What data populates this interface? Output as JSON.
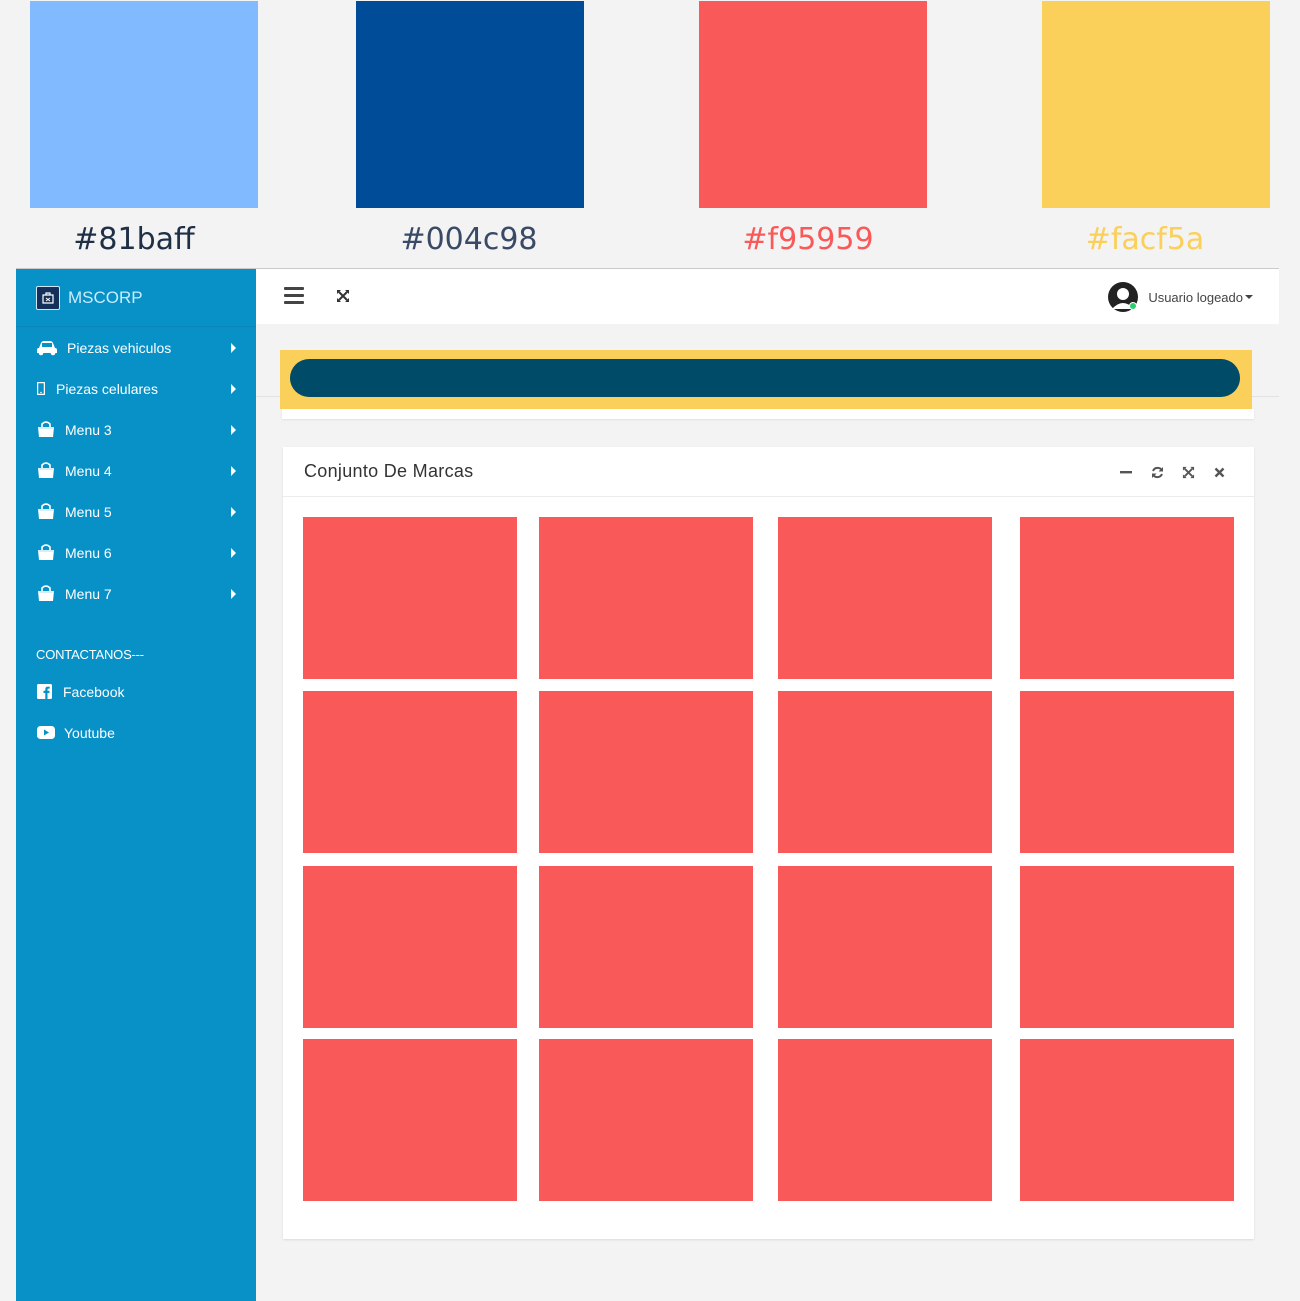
{
  "palette": [
    {
      "label": "#81baff",
      "color": "#81baff",
      "text_color": "#1f2f45"
    },
    {
      "label": "#004c98",
      "color": "#004c98",
      "text_color": "#3a4a66"
    },
    {
      "label": "#f95959",
      "color": "#f95959",
      "text_color": "#f95959"
    },
    {
      "label": "#facf5a",
      "color": "#facf5a",
      "text_color": "#facf5a"
    }
  ],
  "sidebar": {
    "brand": "MSCORP",
    "items": [
      {
        "label": "Piezas vehiculos",
        "icon": "car-icon"
      },
      {
        "label": "Piezas celulares",
        "icon": "mobile-icon"
      },
      {
        "label": "Menu 3",
        "icon": "shopping-bag-icon"
      },
      {
        "label": "Menu 4",
        "icon": "shopping-bag-icon"
      },
      {
        "label": "Menu 5",
        "icon": "shopping-bag-icon"
      },
      {
        "label": "Menu 6",
        "icon": "shopping-bag-icon"
      },
      {
        "label": "Menu 7",
        "icon": "shopping-bag-icon"
      }
    ],
    "contact_title": "CONTACTANOS---",
    "contact_items": [
      {
        "label": "Facebook",
        "icon": "facebook-icon"
      },
      {
        "label": "Youtube",
        "icon": "youtube-icon"
      }
    ]
  },
  "topbar": {
    "user_label": "Usuario logeado"
  },
  "panel": {
    "title": "Conjunto De Marcas",
    "tile_color": "#f95959",
    "tile_count": 16
  },
  "colors": {
    "sidebar": "#0891c7",
    "banner": "#facf5a",
    "banner_bar": "#004b68"
  }
}
